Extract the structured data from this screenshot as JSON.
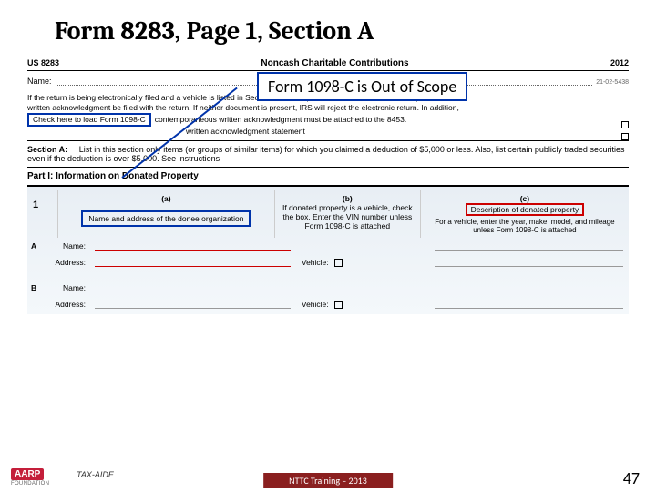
{
  "title": "Form 8283, Page 1, Section A",
  "form": {
    "id": "US 8283",
    "name": "Noncash Charitable Contributions",
    "year": "2012",
    "nameLabel": "Name:",
    "ssn": "21-02-5438"
  },
  "callout": "Form 1098-C is Out of Scope",
  "note": {
    "l1": "If the return is being electronically filed and a vehicle is listed in Section A, IRS requires Form 1098-C or a contemporaneous",
    "l2": "written acknowledgment be filed with the return. If neither document is present, IRS will reject the electronic return. In addition,",
    "l3": "contemporaneous written acknowledgment must be attached to the 8453.",
    "box": "Check here to load Form 1098-C",
    "l4": "written acknowledgment statement"
  },
  "sectionA": {
    "label": "Section A:",
    "text": "List in this section only items (or groups of similar items) for which you claimed a deduction of $5,000 or less. Also, list certain publicly traded securities even if the deduction is over $5,000. See instructions"
  },
  "part1": "Part I:  Information on Donated Property",
  "cols": {
    "n1": "1",
    "a": "(a)",
    "aBox": "Name and address of the donee organization",
    "b": "(b)",
    "bText": "If donated property is a vehicle, check the box. Enter the VIN number unless Form 1098-C is attached",
    "c": "(c)",
    "cBox": "Description of donated property",
    "cText": "For a vehicle, enter the year, make, model, and mileage unless Form 1098-C is attached"
  },
  "rows": {
    "A": "A",
    "B": "B",
    "name": "Name:",
    "addr": "Address:",
    "veh": "Vehicle:"
  },
  "footer": {
    "bar": "NTTC Training – 2013",
    "page": "47",
    "logo": "AARP",
    "logoSub": "FOUNDATION",
    "taxaide": "TAX-AIDE"
  }
}
